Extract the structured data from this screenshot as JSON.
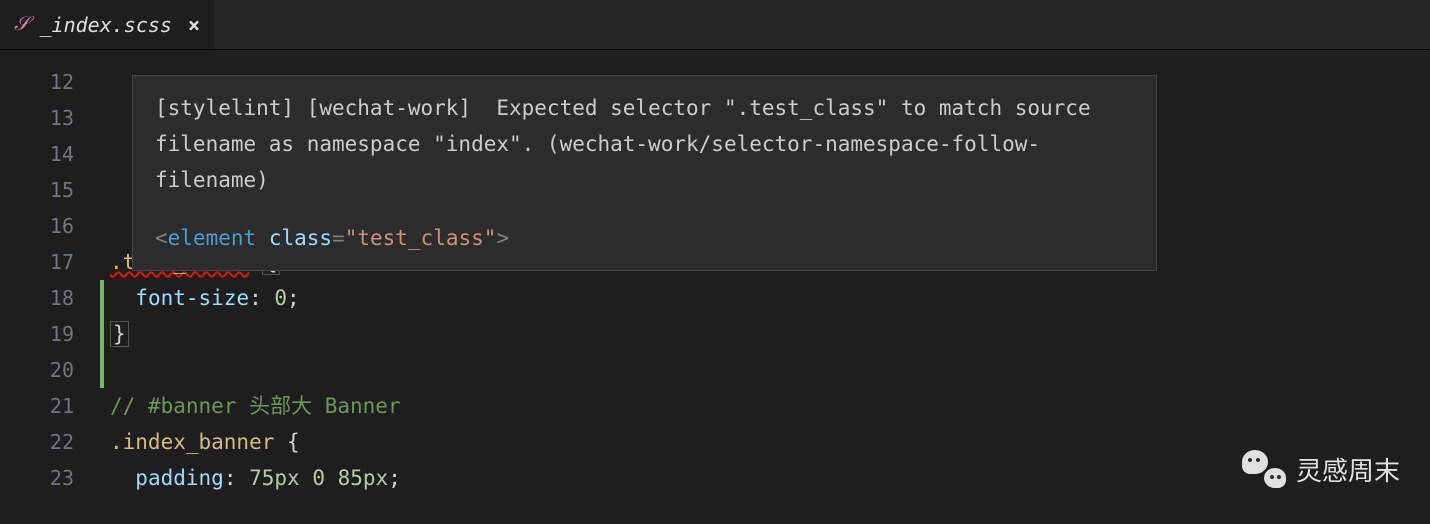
{
  "tab": {
    "filename": "_index.scss",
    "icon_label": "scss-file-icon"
  },
  "line_numbers": [
    "12",
    "13",
    "14",
    "15",
    "16",
    "17",
    "18",
    "19",
    "20",
    "21",
    "22",
    "23"
  ],
  "tooltip": {
    "message": "[stylelint] [wechat-work]  Expected selector \".test_class\" to match source filename as namespace \"index\". (wechat-work/selector-namespace-follow-filename)",
    "snippet": {
      "element": "element",
      "attr": "class",
      "value": "test_class"
    }
  },
  "code": {
    "line17_selector": ".test_class",
    "line17_brace": "{",
    "line18_prop": "font-size",
    "line18_val": "0",
    "line19_brace": "}",
    "line21_comment": "// #banner 头部大 Banner",
    "line22_selector": ".index_banner",
    "line22_brace": "{",
    "line23_prop": "padding",
    "line23_val": "75px 0 85px"
  },
  "watermark": {
    "text": "灵感周末"
  }
}
